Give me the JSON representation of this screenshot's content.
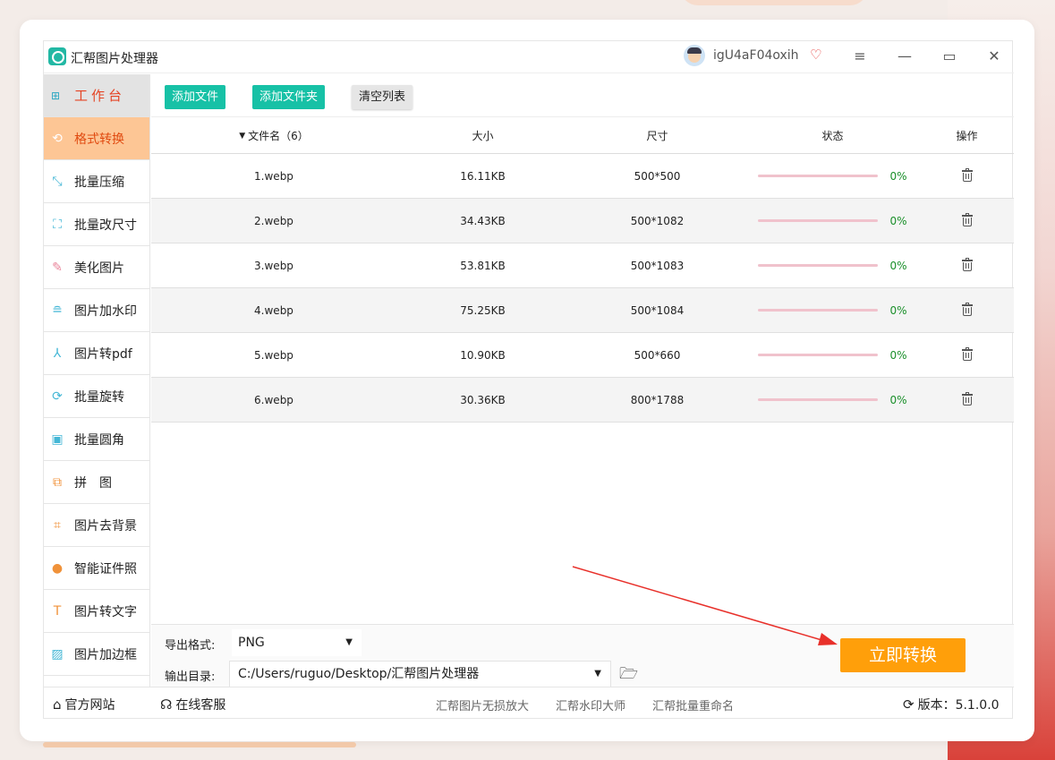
{
  "app": {
    "title": "汇帮图片处理器",
    "username": "igU4aF04oxih"
  },
  "window_controls": {
    "menu": "≡",
    "minimize": "—",
    "maximize": "▭",
    "close": "✕"
  },
  "sidebar": {
    "items": [
      {
        "label": "工作台",
        "icon": "grid-icon"
      },
      {
        "label": "格式转换",
        "icon": "convert-icon"
      },
      {
        "label": "批量压缩",
        "icon": "compress-icon"
      },
      {
        "label": "批量改尺寸",
        "icon": "resize-icon"
      },
      {
        "label": "美化图片",
        "icon": "beautify-icon"
      },
      {
        "label": "图片加水印",
        "icon": "watermark-icon"
      },
      {
        "label": "图片转pdf",
        "icon": "pdf-icon"
      },
      {
        "label": "批量旋转",
        "icon": "rotate-icon"
      },
      {
        "label": "批量圆角",
        "icon": "round-corner-icon"
      },
      {
        "label": "拼　图",
        "icon": "collage-icon"
      },
      {
        "label": "图片去背景",
        "icon": "crop-icon"
      },
      {
        "label": "智能证件照",
        "icon": "person-icon"
      },
      {
        "label": "图片转文字",
        "icon": "text-icon"
      },
      {
        "label": "图片加边框",
        "icon": "frame-icon"
      }
    ],
    "active_index": 1
  },
  "toolbar": {
    "add_file": "添加文件",
    "add_folder": "添加文件夹",
    "clear_list": "清空列表"
  },
  "table": {
    "headers": {
      "name": "文件名（6）",
      "size": "大小",
      "dim": "尺寸",
      "status": "状态",
      "op": "操作"
    },
    "rows": [
      {
        "name": "1.webp",
        "size": "16.11KB",
        "dim": "500*500",
        "progress": "0%"
      },
      {
        "name": "2.webp",
        "size": "34.43KB",
        "dim": "500*1082",
        "progress": "0%"
      },
      {
        "name": "3.webp",
        "size": "53.81KB",
        "dim": "500*1083",
        "progress": "0%"
      },
      {
        "name": "4.webp",
        "size": "75.25KB",
        "dim": "500*1084",
        "progress": "0%"
      },
      {
        "name": "5.webp",
        "size": "10.90KB",
        "dim": "500*660",
        "progress": "0%"
      },
      {
        "name": "6.webp",
        "size": "30.36KB",
        "dim": "800*1788",
        "progress": "0%"
      }
    ]
  },
  "settings": {
    "format_label": "导出格式:",
    "format_value": "PNG",
    "dir_label": "输出目录:",
    "dir_value": "C:/Users/ruguo/Desktop/汇帮图片处理器"
  },
  "convert_button": "立即转换",
  "footer": {
    "site": "官方网站",
    "service": "在线客服",
    "link1": "汇帮图片无损放大",
    "link2": "汇帮水印大师",
    "link3": "汇帮批量重命名",
    "version_label": "版本：",
    "version": "5.1.0.0"
  },
  "colors": {
    "accent": "#17c1a6",
    "active_tab": "#fdc695",
    "convert": "#ff9f0a",
    "arrow": "#e8302a"
  }
}
